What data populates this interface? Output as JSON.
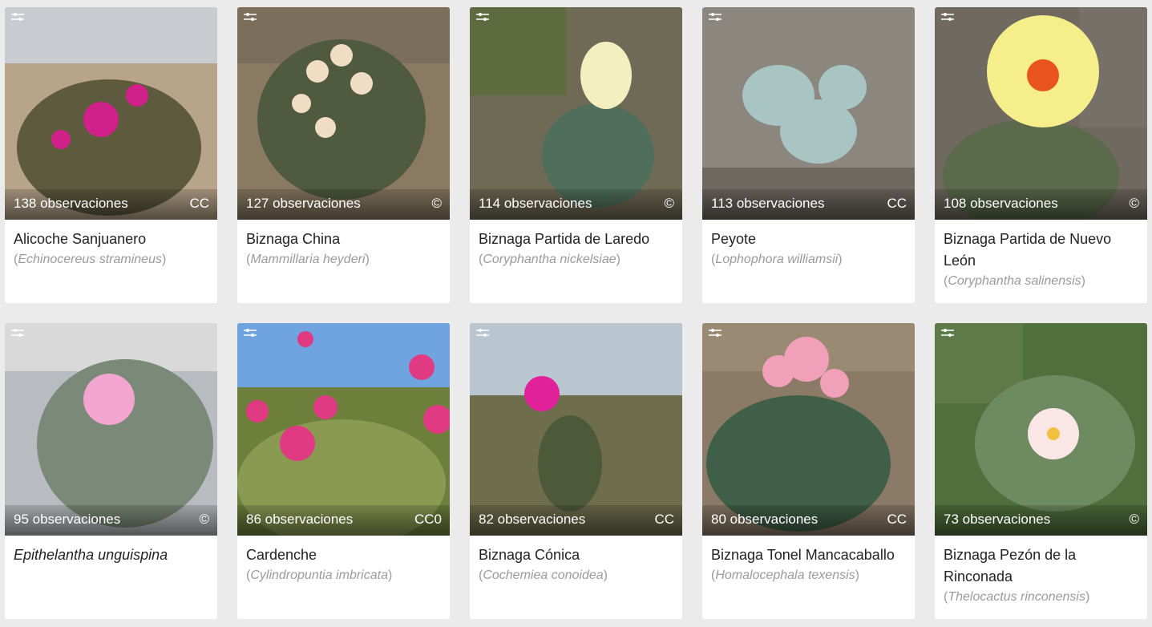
{
  "taxa": [
    {
      "count": "138 observaciones",
      "license": "CC",
      "common": "Alicoche Sanjuanero",
      "scientific": "Echinocereus stramineus",
      "bg1": "#b7a48a",
      "bg2": "#5e5a3e",
      "sky": "#c8ccd0",
      "flower": "#d0218a"
    },
    {
      "count": "127 observaciones",
      "license": "©",
      "common": "Biznaga China",
      "scientific": "Mammillaria heyderi",
      "bg1": "#8a7a62",
      "bg2": "#4f5a3e",
      "sky": "#7b6e5a",
      "flower": "#f1dcc4"
    },
    {
      "count": "114 observaciones",
      "license": "©",
      "common": "Biznaga Partida de Laredo",
      "scientific": "Coryphantha nickelsiae",
      "bg1": "#6f6a55",
      "bg2": "#4f6f5c",
      "sky": "#5d6b3f",
      "flower": "#f4efc0"
    },
    {
      "count": "113 observaciones",
      "license": "CC",
      "common": "Peyote",
      "scientific": "Lophophora williamsii",
      "bg1": "#8c877e",
      "bg2": "#8fb0ae",
      "sky": "#6d6860",
      "flower": "#a8c4c3"
    },
    {
      "count": "108 observaciones",
      "license": "©",
      "common": "Biznaga Partida de Nuevo León",
      "scientific": "Coryphantha salinensis",
      "bg1": "#6f6960",
      "bg2": "#5b6a4a",
      "sky": "#777068",
      "flower": "#f6ee8a"
    },
    {
      "count": "95 observaciones",
      "license": "©",
      "common": "Epithelantha unguispina",
      "scientific": "",
      "bg1": "#b8bcc0",
      "bg2": "#7b8a78",
      "sky": "#d9d9d9",
      "flower": "#f2a6cf"
    },
    {
      "count": "86 observaciones",
      "license": "CC0",
      "common": "Cardenche",
      "scientific": "Cylindropuntia imbricata",
      "bg1": "#6e7f3c",
      "bg2": "#8a9a52",
      "sky": "#6fa4e0",
      "flower": "#e03a82"
    },
    {
      "count": "82 observaciones",
      "license": "CC",
      "common": "Biznaga Cónica",
      "scientific": "Cochemiea conoidea",
      "bg1": "#6f6e4c",
      "bg2": "#4c5a3a",
      "sky": "#b9c6cf",
      "flower": "#e0219a"
    },
    {
      "count": "80 observaciones",
      "license": "CC",
      "common": "Biznaga Tonel Mancacaballo",
      "scientific": "Homalocephala texensis",
      "bg1": "#8a7a66",
      "bg2": "#3f5f48",
      "sky": "#9a8a74",
      "flower": "#f0a0b8"
    },
    {
      "count": "73 observaciones",
      "license": "©",
      "common": "Biznaga Pezón de la Rinconada",
      "scientific": "Thelocactus rinconensis",
      "bg1": "#4f6f3c",
      "bg2": "#6e8a60",
      "sky": "#5e7a48",
      "flower": "#fbe6e6"
    }
  ]
}
